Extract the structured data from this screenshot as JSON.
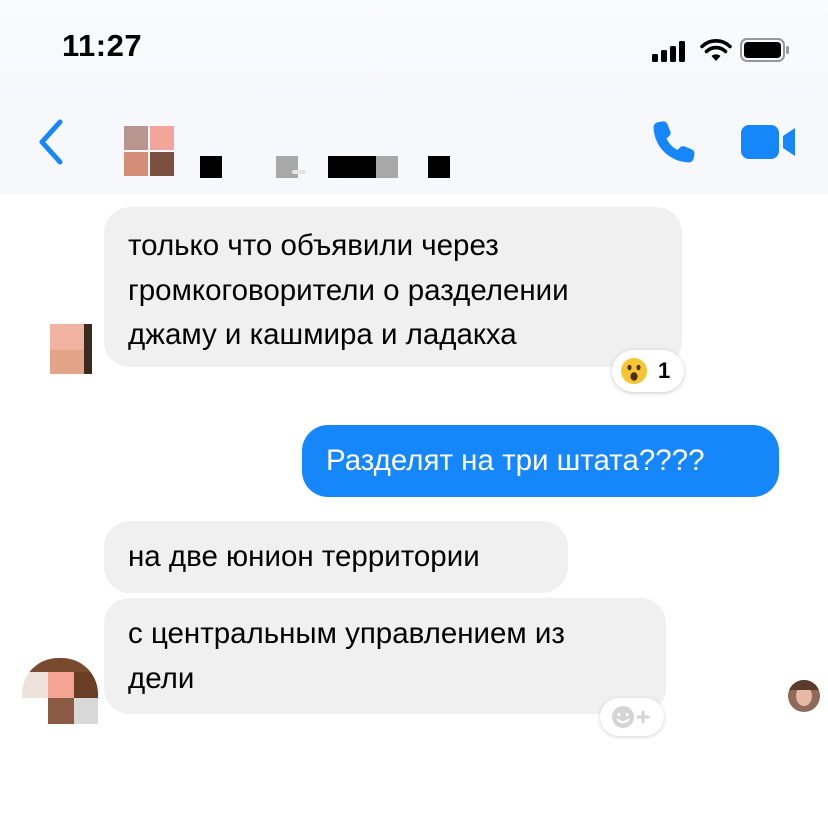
{
  "status_bar": {
    "time": "11:27"
  },
  "header": {
    "contact_name": ""
  },
  "messages": [
    {
      "direction": "incoming",
      "lines": [
        "только что объявили через",
        "громкоговорители о разделении",
        "джаму и кашмира и ладакха"
      ]
    },
    {
      "direction": "outgoing",
      "lines": [
        "Разделят на три штата????"
      ]
    },
    {
      "direction": "incoming",
      "lines": [
        "на две юнион территории"
      ]
    },
    {
      "direction": "incoming",
      "lines": [
        "с центральным управлением из",
        "дели"
      ]
    }
  ],
  "reaction": {
    "emoji": "astonished-face-icon",
    "count": "1"
  },
  "colors": {
    "accent": "#1686fb",
    "incoming_bubble": "#f0f0f0",
    "background": "#ffffff"
  }
}
